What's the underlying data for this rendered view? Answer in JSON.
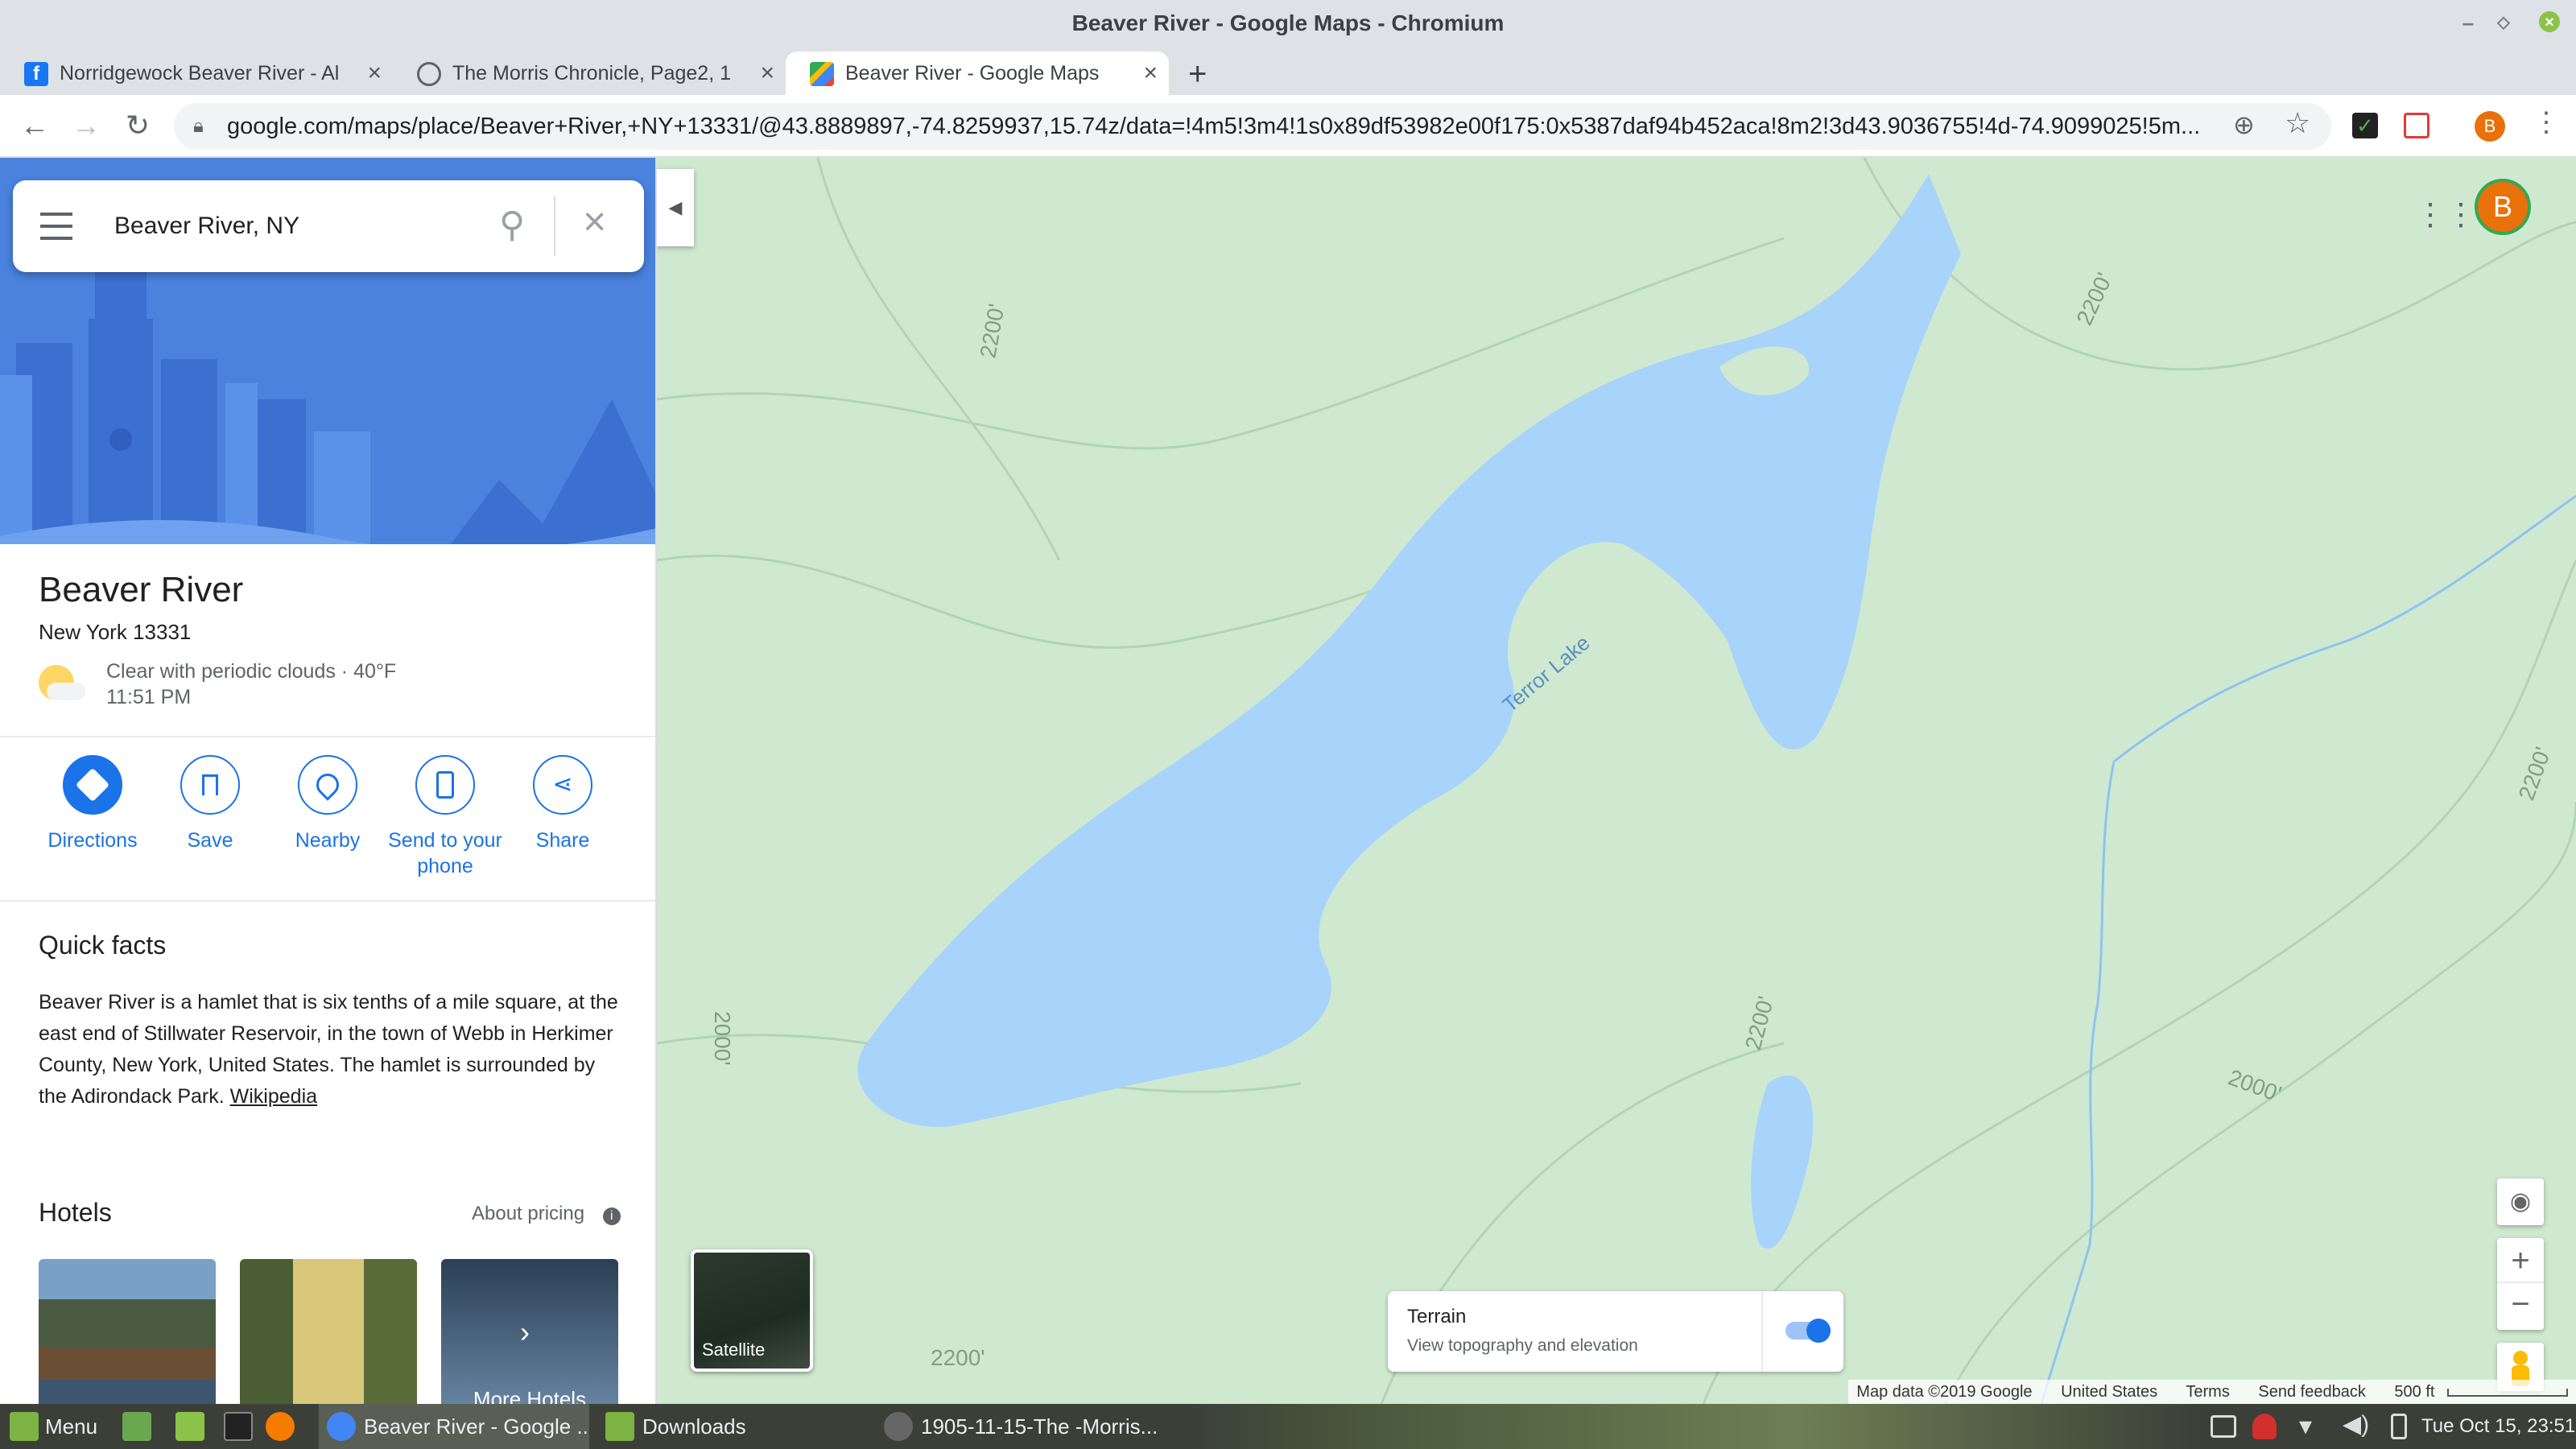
{
  "window": {
    "title": "Beaver River - Google Maps - Chromium"
  },
  "tabs": [
    {
      "label": "Norridgewock Beaver River - Al",
      "favicon": "facebook-icon",
      "color": "#1877f2"
    },
    {
      "label": "The Morris Chronicle, Page2, 1",
      "favicon": "globe-icon",
      "color": "#5f6368"
    },
    {
      "label": "Beaver River - Google Maps",
      "favicon": "maps-icon",
      "color": "#34a853"
    }
  ],
  "address_bar": {
    "url": "google.com/maps/place/Beaver+River,+NY+13331/@43.8889897,-74.8259937,15.74z/data=!4m5!3m4!1s0x89df53982e00f175:0x5387daf94b452aca!8m2!3d43.9036755!4d-74.9099025!5m..."
  },
  "profile": {
    "initial": "B",
    "color": "#e8710a"
  },
  "search": {
    "query": "Beaver River, NY"
  },
  "place": {
    "name": "Beaver River",
    "address": "New York 13331",
    "weather": "Clear with periodic clouds · 40°F",
    "time": "11:51 PM"
  },
  "actions": [
    {
      "label": "Directions",
      "icon": "directions-icon"
    },
    {
      "label": "Save",
      "icon": "bookmark-icon"
    },
    {
      "label": "Nearby",
      "icon": "nearby-icon"
    },
    {
      "label_line1": "Send to your",
      "label_line2": "phone",
      "icon": "send-to-phone-icon"
    },
    {
      "label": "Share",
      "icon": "share-icon"
    }
  ],
  "quick_facts": {
    "heading": "Quick facts",
    "text": "Beaver River is a hamlet that is six tenths of a mile square, at the east end of Stillwater Reservoir, in the town of Webb in Herkimer County, New York, United States. The hamlet is surrounded by the Adirondack Park.",
    "link": "Wikipedia"
  },
  "hotels": {
    "heading": "Hotels",
    "pricing": "About pricing",
    "more": "More Hotels"
  },
  "map": {
    "lake_label": "Terror Lake",
    "contours": [
      "2200'",
      "2000'",
      "2200'",
      "2200'",
      "2200'",
      "2000'",
      "2200'"
    ],
    "satellite_label": "Satellite",
    "terrain_title": "Terrain",
    "terrain_sub": "View topography and elevation",
    "terrain_on": true,
    "attribution": [
      "Map data ©2019 Google",
      "United States",
      "Terms",
      "Send feedback",
      "500 ft"
    ],
    "water_color": "#a8d3fb",
    "land_color": "#cfe9d0"
  },
  "taskbar": {
    "menu": "Menu",
    "items": [
      "Beaver River - Google ...",
      "Downloads",
      "1905-11-15-The -Morris..."
    ],
    "clock": "Tue Oct 15, 23:51"
  }
}
